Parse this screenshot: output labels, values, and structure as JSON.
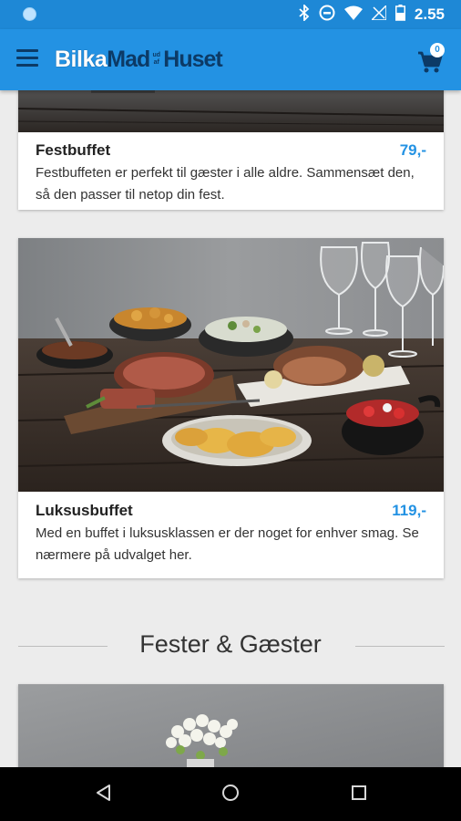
{
  "status_bar": {
    "time": "2.55"
  },
  "app_bar": {
    "logo_bilka": "Bilka",
    "logo_mad": "Mad",
    "logo_fra": "ud af",
    "logo_huset": "Huset",
    "cart_count": "0"
  },
  "cards": [
    {
      "title": "Festbuffet",
      "price": "79,-",
      "description": "Festbuffeten er perfekt til gæster i alle aldre. Sammensæt den, så den passer til netop din fest."
    },
    {
      "title": "Luksusbuffet",
      "price": "119,-",
      "description": "Med en buffet i luksusklassen er der noget for enhver smag. Se nærmere på udvalget her."
    }
  ],
  "section": {
    "title": "Fester & Gæster"
  },
  "colors": {
    "accent": "#2392e3",
    "status_bar": "#1e88d6",
    "logo_dark": "#0c3a66"
  }
}
